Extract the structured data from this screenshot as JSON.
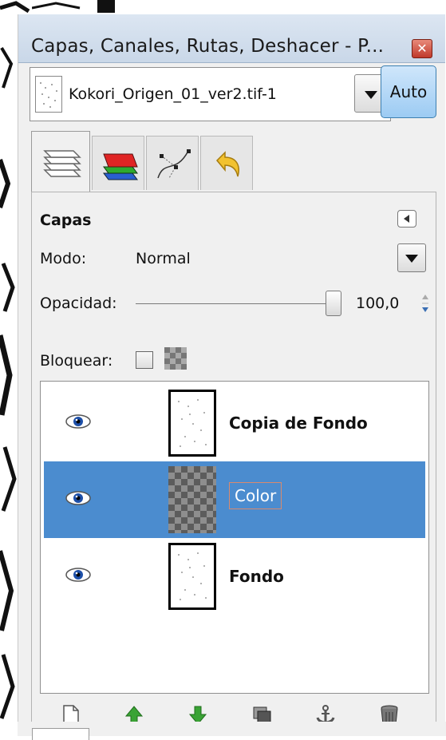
{
  "window": {
    "title": "Capas, Canales, Rutas, Deshacer - P...",
    "close_icon": "close-icon"
  },
  "image_selector": {
    "filename": "Kokori_Origen_01_ver2.tif-1",
    "auto_label": "Auto"
  },
  "tabs": [
    {
      "name": "layers",
      "icon": "layers-icon",
      "active": true
    },
    {
      "name": "channels",
      "icon": "channels-icon",
      "active": false
    },
    {
      "name": "paths",
      "icon": "paths-icon",
      "active": false
    },
    {
      "name": "undo",
      "icon": "undo-icon",
      "active": false
    }
  ],
  "layers_panel": {
    "title": "Capas",
    "mode_label": "Modo:",
    "mode_value": "Normal",
    "opacity_label": "Opacidad:",
    "opacity_value": "100,0",
    "opacity_fraction": 1.0,
    "lock_label": "Bloquear:"
  },
  "layers": [
    {
      "name": "Copia de Fondo",
      "visible": true,
      "selected": false,
      "thumb": "drawing"
    },
    {
      "name": "Color",
      "visible": true,
      "selected": true,
      "thumb": "transparent"
    },
    {
      "name": "Fondo",
      "visible": true,
      "selected": false,
      "thumb": "drawing"
    }
  ],
  "footer_buttons": [
    {
      "name": "new-layer",
      "icon": "new-page-icon"
    },
    {
      "name": "raise-layer",
      "icon": "arrow-up-icon"
    },
    {
      "name": "lower-layer",
      "icon": "arrow-down-icon"
    },
    {
      "name": "duplicate-layer",
      "icon": "duplicate-icon"
    },
    {
      "name": "anchor-layer",
      "icon": "anchor-icon"
    },
    {
      "name": "delete-layer",
      "icon": "trash-icon"
    }
  ],
  "colors": {
    "selection": "#4b8ccf",
    "auto_button": "#9ccbf3",
    "raise_green": "#3aa335",
    "close_red": "#c0392b"
  }
}
